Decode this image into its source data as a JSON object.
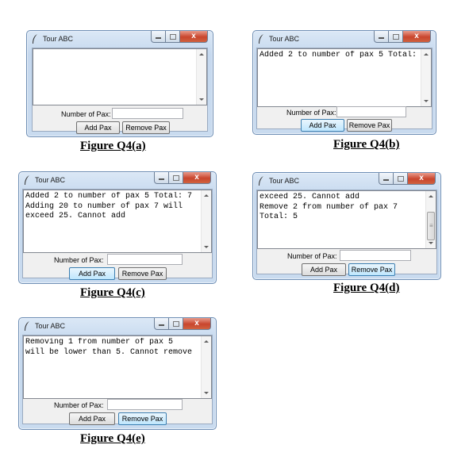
{
  "app": {
    "window_title": "Tour ABC",
    "pax_label": "Number of Pax:",
    "add_label": "Add Pax",
    "remove_label": "Remove Pax"
  },
  "figures": [
    {
      "caption": "Figure Q4(a)",
      "text": "",
      "focus": ""
    },
    {
      "caption": "Figure Q4(b)",
      "text": "Added 2 to number of pax 5 Total: 7",
      "focus": "add"
    },
    {
      "caption": "Figure Q4(c)",
      "text": "Added 2 to number of pax 5 Total: 7\nAdding 20 to number of pax 7 will\nexceed 25. Cannot add",
      "focus": "add"
    },
    {
      "caption": "Figure Q4(d)",
      "text": "exceed 25. Cannot add\nRemove 2 from number of pax 7\nTotal: 5",
      "focus": "remove"
    },
    {
      "caption": "Figure Q4(e)",
      "text": "Removing 1 from number of pax 5\nwill be lower than 5. Cannot remove",
      "focus": "remove"
    }
  ]
}
